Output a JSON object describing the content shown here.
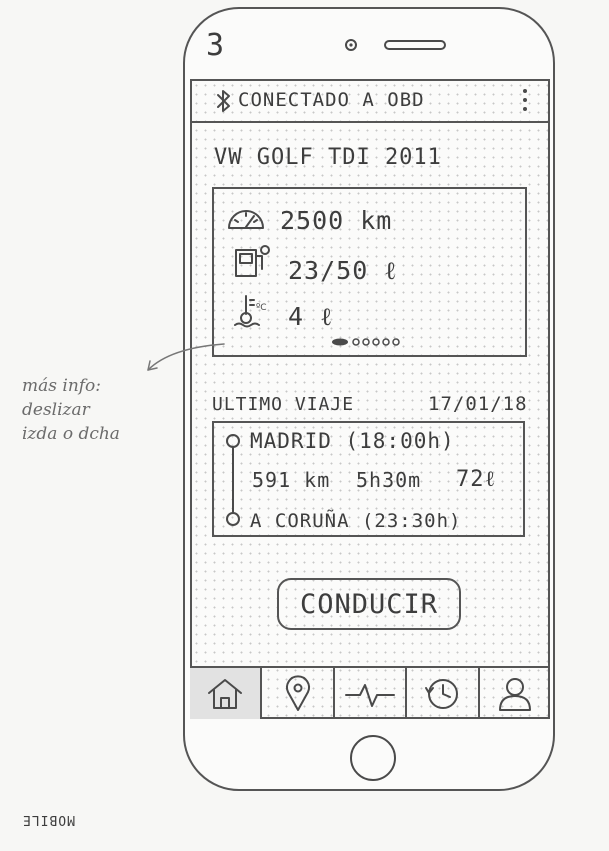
{
  "screen_number": "3",
  "topbar": {
    "status": "CONECTADO A OBD",
    "bluetooth_icon": "bluetooth-icon",
    "menu_icon": "more-vertical-icon"
  },
  "vehicle": {
    "name": "VW GOLF TDI 2011"
  },
  "stats": {
    "mileage": "2500 km",
    "fuel": "23/50 ℓ",
    "oil": "4 ℓ",
    "pager": {
      "total": 5,
      "active": 1
    }
  },
  "last_trip": {
    "heading": "ULTIMO VIAJE",
    "date": "17/01/18",
    "origin": "MADRID (18:00h)",
    "distance": "591 km",
    "duration": "5h30m",
    "fuel": "72ℓ",
    "destination": "A CORUÑA (23:30h)"
  },
  "drive_button": "CONDUCIR",
  "nav": [
    "home-icon",
    "map-pin-icon",
    "activity-icon",
    "history-icon",
    "user-icon"
  ],
  "annotation": [
    "más info:",
    "deslizar",
    "izda o dcha"
  ],
  "footer_label": "MOBILE"
}
